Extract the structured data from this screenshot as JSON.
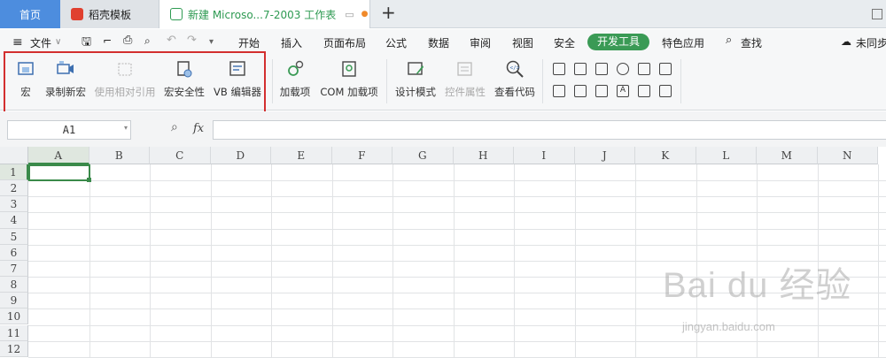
{
  "tabs": {
    "home": "首页",
    "template": "稻壳模板",
    "doc": "新建 Microso...7-2003 工作表",
    "plus": "+"
  },
  "menu": {
    "file": "文件",
    "items": [
      "开始",
      "插入",
      "页面布局",
      "公式",
      "数据",
      "审阅",
      "视图",
      "安全"
    ],
    "active": "开发工具",
    "special": "特色应用",
    "search": "查找",
    "right": "未同步"
  },
  "ribbon": {
    "macro": "宏",
    "record": "录制新宏",
    "relative": "使用相对引用",
    "security": "宏安全性",
    "vb": "VB 编辑器",
    "addins": "加载项",
    "com": "COM 加载项",
    "design": "设计模式",
    "props": "控件属性",
    "code": "查看代码"
  },
  "formula_bar": {
    "name_box": "A1",
    "fx": "fx"
  },
  "grid": {
    "columns": [
      "A",
      "B",
      "C",
      "D",
      "E",
      "F",
      "G",
      "H",
      "I",
      "J",
      "K",
      "L",
      "M",
      "N"
    ],
    "rows": [
      "1",
      "2",
      "3",
      "4",
      "5",
      "6",
      "7",
      "8",
      "9",
      "10",
      "11",
      "12"
    ]
  },
  "watermark": {
    "main": "Bai du 经验",
    "sub": "jingyan.baidu.com"
  },
  "colors": {
    "accent": "#3a9a55",
    "home_tab": "#4d8dde",
    "highlight_box": "#d32f2f"
  }
}
